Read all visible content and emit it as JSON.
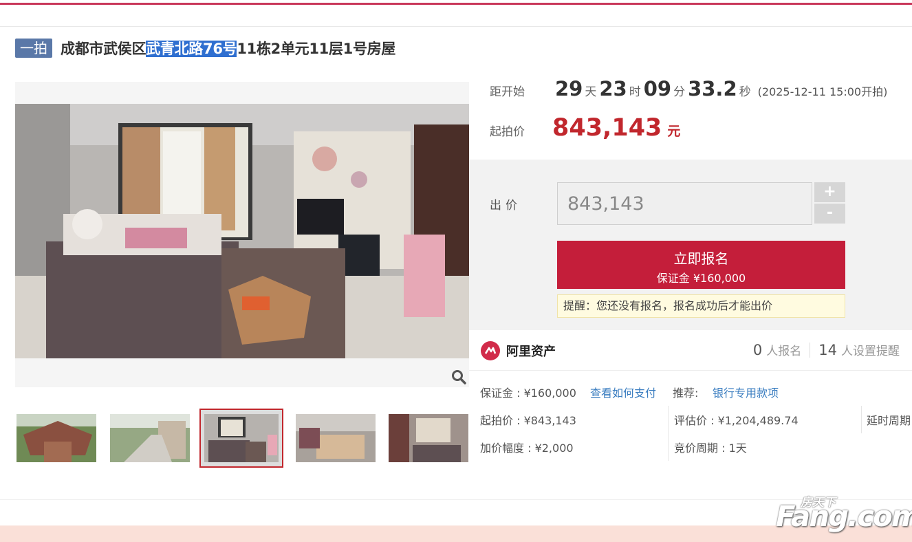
{
  "header": {
    "round_badge": "一拍",
    "title_pre": "成都市武侯区",
    "title_highlight": "武青北路76号",
    "title_post": "11栋2单元11层1号房屋"
  },
  "countdown": {
    "label": "距开始",
    "days": "29",
    "days_unit": "天",
    "hours": "23",
    "hours_unit": "时",
    "minutes": "09",
    "minutes_unit": "分",
    "seconds": "33.2",
    "seconds_unit": "秒",
    "start_note": "(2025-12-11 15:00开拍)"
  },
  "start_price": {
    "label": "起拍价",
    "value": "843,143",
    "unit": "元"
  },
  "bid": {
    "label": "出价",
    "value": "843,143",
    "plus": "+",
    "minus": "-",
    "signup_main": "立即报名",
    "signup_sub": "保证金 ¥160,000",
    "tip": "提醒：您还没有报名，报名成功后才能出价"
  },
  "platform": {
    "name": "阿里资产",
    "signups_num": "0",
    "signups_label": "人报名",
    "reminders_num": "14",
    "reminders_label": "人设置提醒"
  },
  "details": {
    "deposit": "保证金 : ¥160,000",
    "how_to_pay": "查看如何支付",
    "recommend_label": "推荐:",
    "recommend_link": "银行专用款项",
    "start_price": "起拍价 : ¥843,143",
    "appraisal": "评估价 : ¥1,204,489.74",
    "delay": "延时周期",
    "increment": "加价幅度 : ¥2,000",
    "cycle": "竞价周期 : 1天"
  },
  "watermark": {
    "cn": "房天下",
    "en": "Fang.com"
  },
  "colors": {
    "accent_red": "#c1272d",
    "button_red": "#c41e3a",
    "badge_blue": "#5a78a8",
    "link_blue": "#3a7dc0"
  },
  "icons": {
    "zoom": "magnifier-icon",
    "platform": "ali-asset-logo-icon"
  }
}
